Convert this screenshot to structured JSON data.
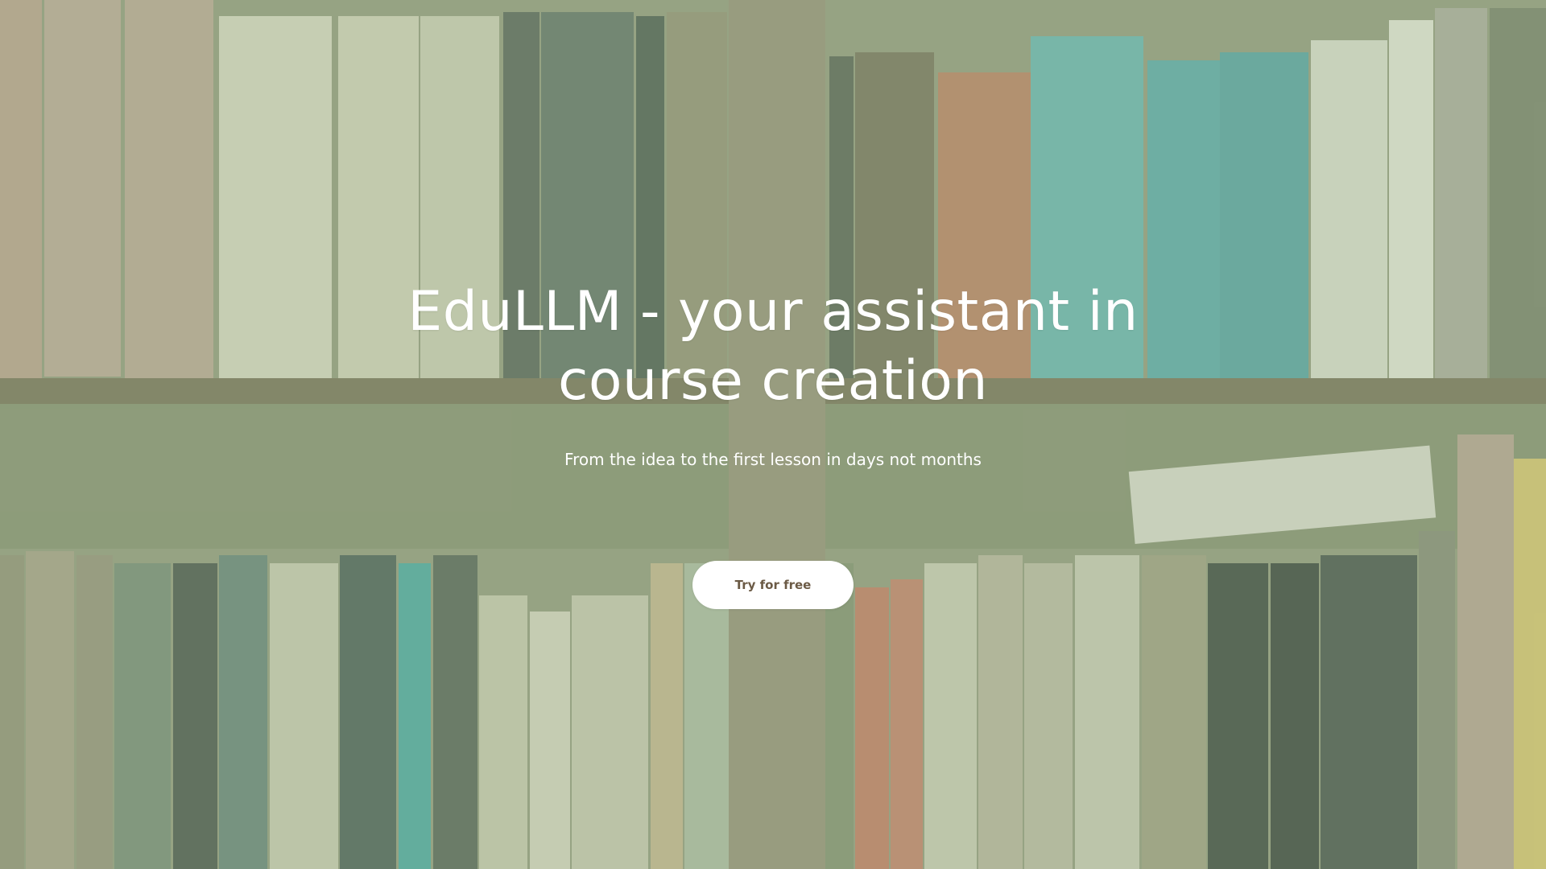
{
  "hero": {
    "title": "EduLLM - your assistant in course creation",
    "subtitle": "From the idea to the first lesson in days not months",
    "cta_label": "Try for free"
  },
  "colors": {
    "text": "#ffffff",
    "button_bg": "#ffffff",
    "button_text": "#6b5a45",
    "overlay": "#aabe96"
  },
  "background_image": "bookshelf-photo"
}
